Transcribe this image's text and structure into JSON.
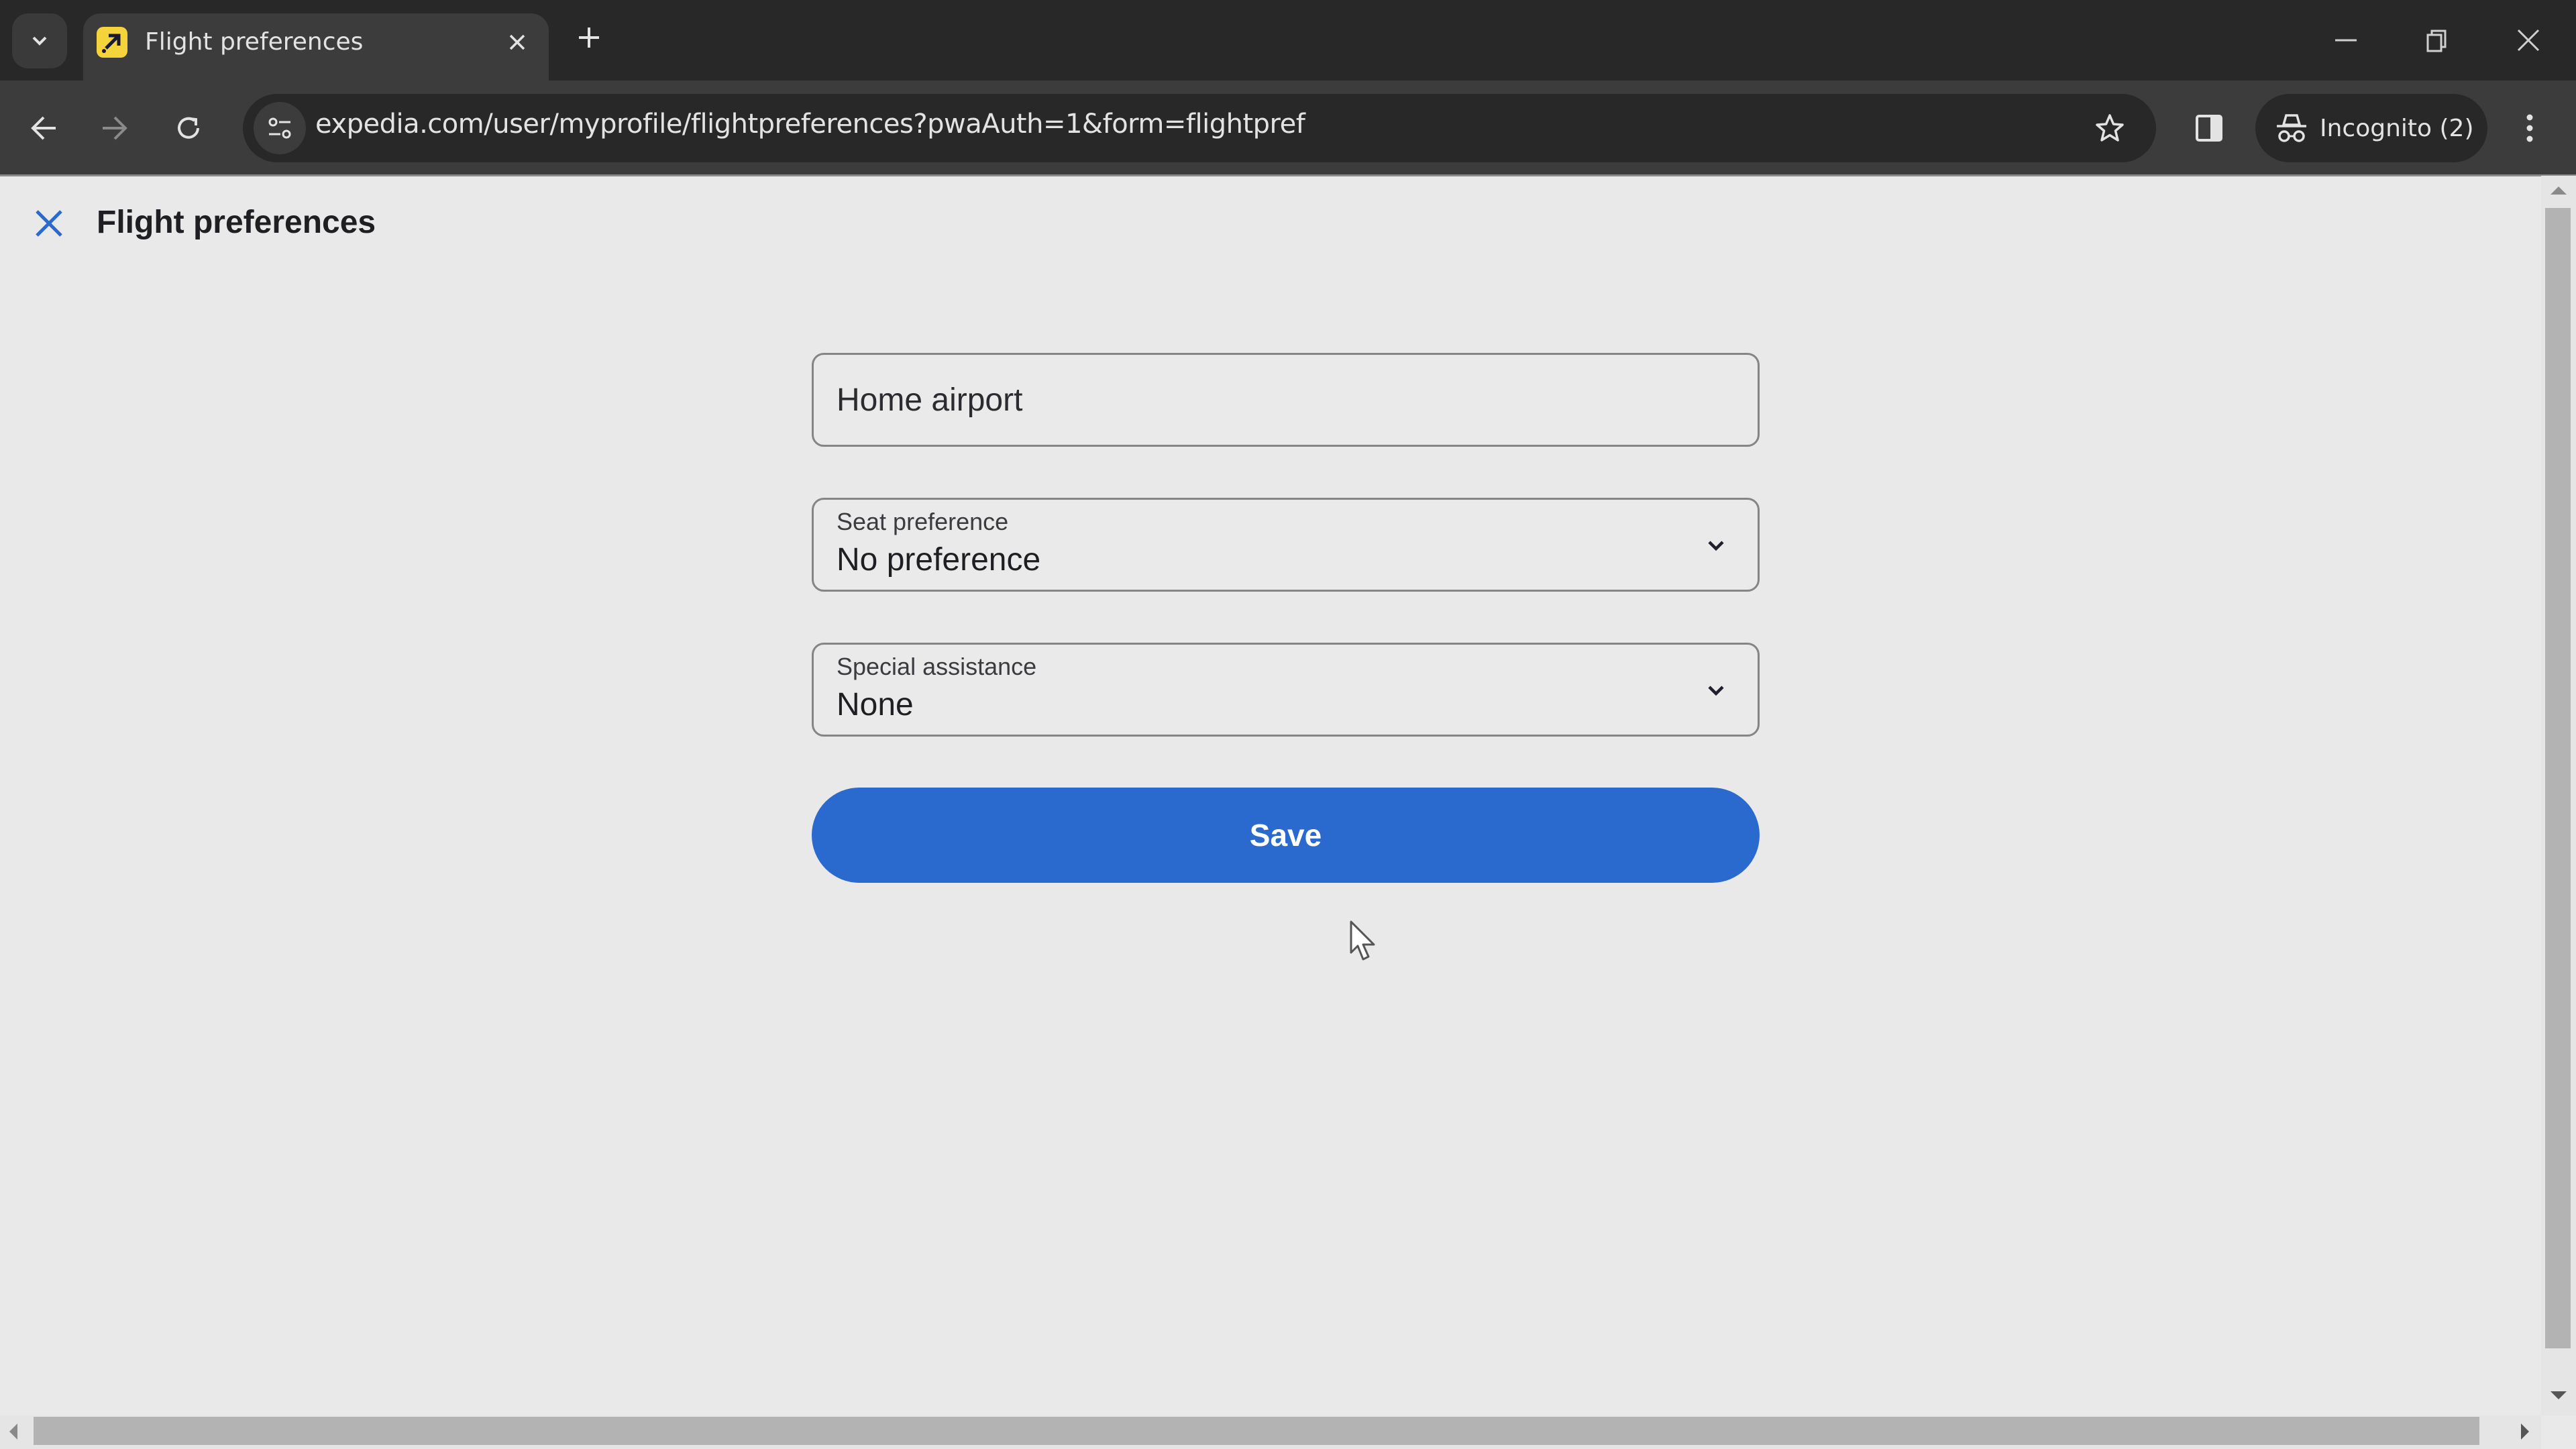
{
  "browser": {
    "tab": {
      "title": "Flight preferences",
      "favicon": "expedia-logo-icon"
    },
    "url": "expedia.com/user/myprofile/flightpreferences?pwaAuth=1&form=flightpref",
    "profile_label": "Incognito (2)",
    "icons": {
      "tab_search": "chevron-down-icon",
      "tab_close": "close-icon",
      "new_tab": "plus-icon",
      "minimize": "minimize-icon",
      "restore": "restore-icon",
      "window_close": "close-icon",
      "back": "arrow-left-icon",
      "forward": "arrow-right-icon",
      "reload": "reload-icon",
      "site_info": "tune-icon",
      "bookmark": "star-icon",
      "side_panel": "side-panel-icon",
      "incognito": "incognito-icon",
      "menu": "kebab-menu-icon"
    }
  },
  "page": {
    "title": "Flight preferences",
    "close_icon": "close-icon",
    "form": {
      "home_airport": {
        "placeholder": "Home airport",
        "value": ""
      },
      "seat_preference": {
        "label": "Seat preference",
        "value": "No preference"
      },
      "special_assistance": {
        "label": "Special assistance",
        "value": "None"
      },
      "save_label": "Save"
    }
  },
  "colors": {
    "accent": "#2a6acf",
    "page_background": "#e9e9e9",
    "chrome_dark": "#282828",
    "toolbar": "#3c3c3c",
    "favicon": "#f5d33a"
  }
}
